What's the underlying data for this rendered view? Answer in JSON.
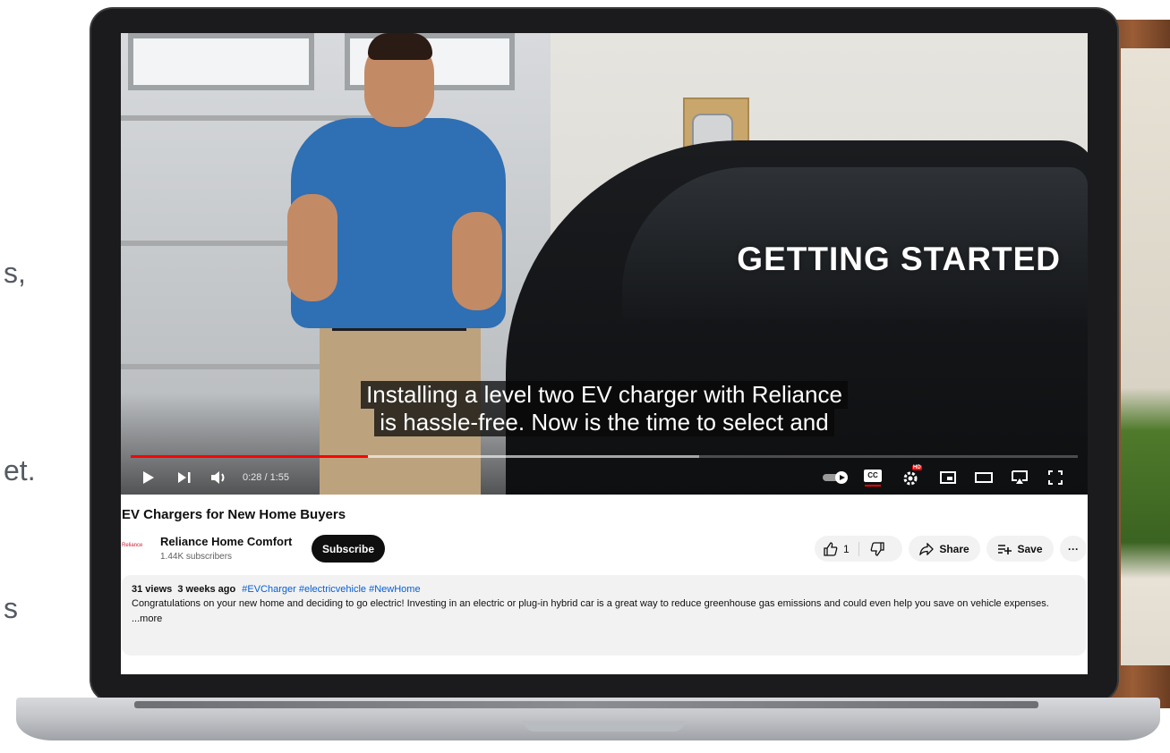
{
  "side_text": {
    "frag1": "s,",
    "frag2": "et.",
    "frag3": "s"
  },
  "video": {
    "overlay_title": "GETTING STARTED",
    "caption_lines": [
      "Installing a level two EV charger with Reliance",
      "is hassle-free. Now is the time to select and"
    ],
    "time_display": "0:28 / 1:55",
    "progress_played_fraction": 0.25,
    "progress_buffered_fraction": 0.6,
    "icons": [
      "play-icon",
      "next-icon",
      "volume-icon",
      "autoplay-toggle-icon",
      "captions-icon",
      "settings-icon",
      "miniplayer-icon",
      "theater-icon",
      "cast-icon",
      "fullscreen-icon"
    ],
    "hd_badge": "HD",
    "cc_label": "CC"
  },
  "details": {
    "title": "EV Chargers for New Home Buyers",
    "channel_logo_text": "Reliance",
    "channel_name": "Reliance Home Comfort",
    "subscribers": "1.44K subscribers",
    "subscribe_label": "Subscribe",
    "like_count": "1",
    "share_label": "Share",
    "save_label": "Save",
    "more_label": "···"
  },
  "description": {
    "meta": "31 views  3 weeks ago",
    "tags": "#EVCharger #electricvehicle #NewHome",
    "text": "Congratulations on your new home and deciding to go electric! Investing in an electric or plug-in hybrid car is a great way to reduce greenhouse gas emissions and could even help you save on vehicle expenses.",
    "more": "...more"
  },
  "colors": {
    "progress_red": "#ff0000",
    "subscribe_bg": "#0f0f0f",
    "pill_bg": "#f2f2f2",
    "shirt_blue": "#2f6fb3",
    "tag_blue": "#065fd4"
  }
}
